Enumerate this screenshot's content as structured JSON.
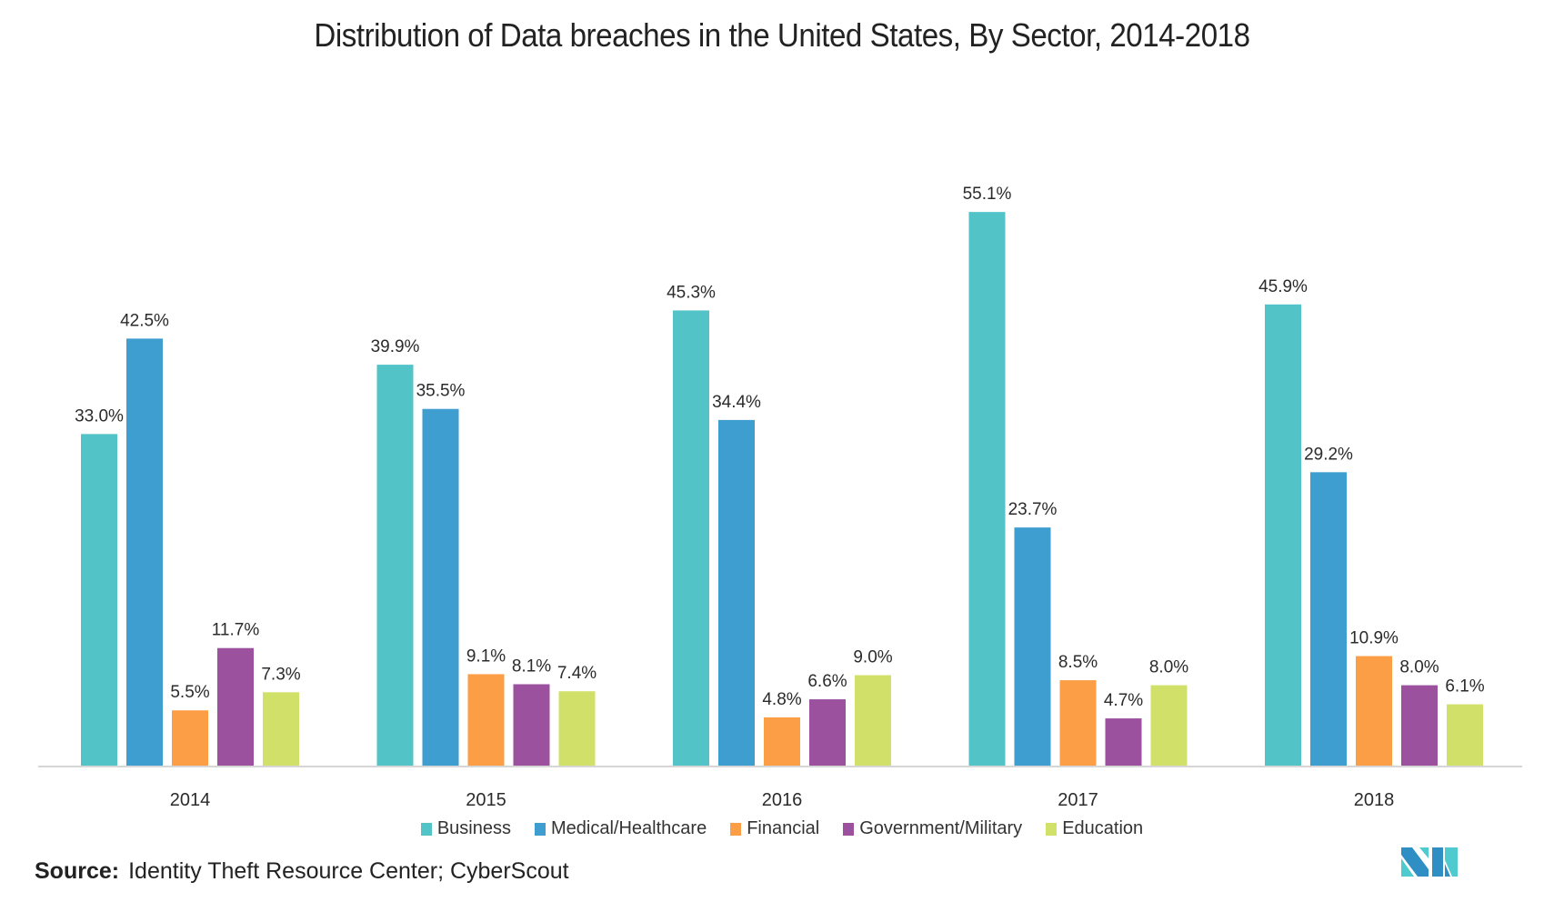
{
  "chart_data": {
    "type": "bar",
    "title": "Distribution of Data breaches in the United States, By Sector, 2014-2018",
    "xlabel": "",
    "ylabel": "",
    "categories": [
      "2014",
      "2015",
      "2016",
      "2017",
      "2018"
    ],
    "series": [
      {
        "name": "Business",
        "color": "#52c3c6",
        "values": [
          33.0,
          39.9,
          45.3,
          55.1,
          45.9
        ],
        "labels": [
          "33.0%",
          "39.9%",
          "45.3%",
          "55.1%",
          "45.9%"
        ]
      },
      {
        "name": "Medical/Healthcare",
        "color": "#3d9ecf",
        "values": [
          42.5,
          35.5,
          34.4,
          23.7,
          29.2
        ],
        "labels": [
          "42.5%",
          "35.5%",
          "34.4%",
          "23.7%",
          "29.2%"
        ]
      },
      {
        "name": "Financial",
        "color": "#fb9e46",
        "values": [
          5.5,
          9.1,
          4.8,
          8.5,
          10.9
        ],
        "labels": [
          "5.5%",
          "9.1%",
          "4.8%",
          "8.5%",
          "10.9%"
        ]
      },
      {
        "name": "Government/Military",
        "color": "#9c519e",
        "values": [
          11.7,
          8.1,
          6.6,
          4.7,
          8.0
        ],
        "labels": [
          "11.7%",
          "8.1%",
          "6.6%",
          "4.7%",
          "8.0%"
        ]
      },
      {
        "name": "Education",
        "color": "#d1e068",
        "values": [
          7.3,
          7.4,
          9.0,
          8.0,
          6.1
        ],
        "labels": [
          "7.3%",
          "7.4%",
          "9.0%",
          "8.0%",
          "6.1%"
        ]
      }
    ],
    "ylim": [
      0,
      60
    ],
    "grid": false,
    "y_axis_visible": false,
    "legend_position": "bottom-center",
    "value_unit": "%"
  },
  "source": {
    "label": "Source:",
    "text": "Identity Theft Resource Center; CyberScout"
  },
  "logo": {
    "name": "Mordor Intelligence logo",
    "colors": [
      "#2f8fc4",
      "#4fcbd0"
    ]
  }
}
